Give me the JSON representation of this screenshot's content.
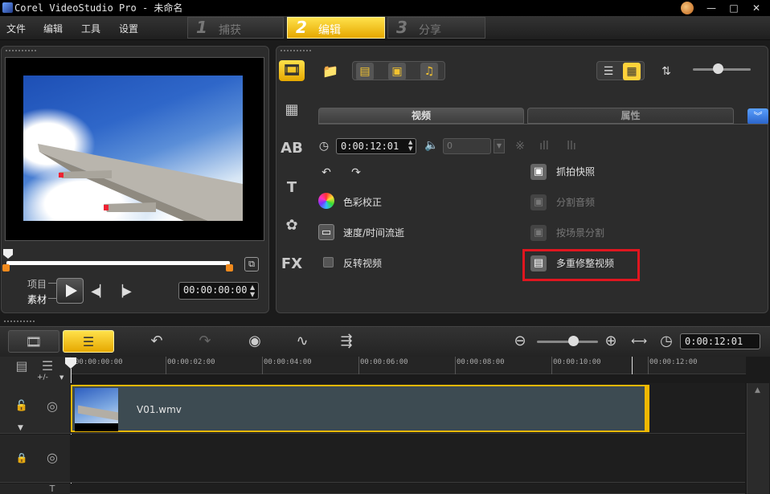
{
  "window": {
    "title": "Corel VideoStudio Pro - 未命名",
    "icons": [
      "app-icon",
      "corel-logo-icon",
      "minimize-icon",
      "maximize-icon",
      "close-icon"
    ]
  },
  "menu": {
    "items": [
      "文件",
      "编辑",
      "工具",
      "设置"
    ]
  },
  "steps": [
    {
      "num": "1",
      "label": "捕获",
      "active": false
    },
    {
      "num": "2",
      "label": "编辑",
      "active": true
    },
    {
      "num": "3",
      "label": "分享",
      "active": false
    }
  ],
  "preview": {
    "mode_project": "项目",
    "mode_clip": "素材",
    "timecode": "00:00:00:00",
    "icons": [
      "play-icon",
      "prev-frame-icon",
      "next-frame-icon",
      "enlarge-icon"
    ]
  },
  "library": {
    "tabs": {
      "video": "视频",
      "properties": "属性"
    },
    "duration": "0:00:12:01",
    "volume": "0",
    "options_left": [
      {
        "icon": "rotate-icon",
        "label": ""
      },
      {
        "icon": "color-correction-icon",
        "label": "色彩校正"
      },
      {
        "icon": "speed-time-icon",
        "label": "速度/时间流逝"
      },
      {
        "icon": "reverse-checkbox",
        "label": "反转视频"
      }
    ],
    "options_right": [
      {
        "icon": "snapshot-icon",
        "label": "抓拍快照",
        "enabled": true
      },
      {
        "icon": "split-audio-icon",
        "label": "分割音频",
        "enabled": false
      },
      {
        "icon": "split-by-scene-icon",
        "label": "按场景分割",
        "enabled": false
      },
      {
        "icon": "multi-trim-icon",
        "label": "多重修整视频",
        "enabled": true,
        "highlighted": true
      }
    ],
    "highlight_color": "#e0161f"
  },
  "timeline": {
    "timecode": "0:00:12:01",
    "ruler": [
      "00:00:00:00",
      "00:00:02:00",
      "00:00:04:00",
      "00:00:06:00",
      "00:00:08:00",
      "00:00:10:00",
      "00:00:12:00"
    ],
    "clip_name": "V01.wmv",
    "add_track": "+/-",
    "accent": "#f0b800"
  }
}
